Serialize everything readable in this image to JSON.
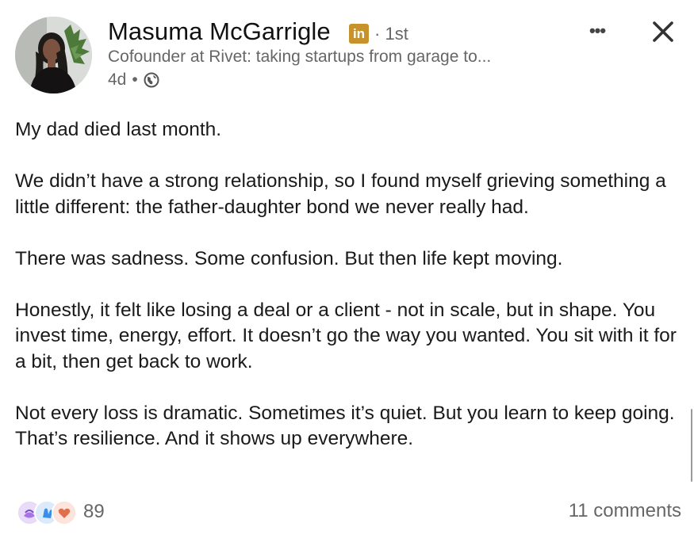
{
  "author": {
    "name": "Masuma McGarrigle",
    "badge": "in",
    "degree": "1st",
    "headline": "Cofounder at Rivet: taking startups from garage to...",
    "time": "4d",
    "visibility_icon": "globe-icon"
  },
  "actions": {
    "more_label": "•••",
    "more_icon": "ellipsis-icon",
    "close_icon": "close-icon"
  },
  "post": {
    "paragraphs": [
      "My dad died last month.",
      "We didn’t have a strong relationship, so I found myself grieving something a little different: the father-daughter bond we never really had.",
      "There was sadness. Some confusion. But then life kept moving.",
      "Honestly, it felt like losing a deal or a client - not in scale, but in shape. You invest time, energy, effort. It doesn’t go the way you wanted. You sit with it for a bit, then get back to work.",
      "Not every loss is dramatic. Sometimes it’s quiet. But you learn to keep going. That’s resilience. And it shows up everywhere."
    ]
  },
  "social": {
    "reaction_count": "89",
    "reaction_icons": [
      "support-icon",
      "celebrate-icon",
      "love-icon"
    ],
    "comments": "11 comments"
  },
  "colors": {
    "badge": "#c7922b",
    "muted_text": "#666666",
    "love": "#df704d",
    "celebrate": "#378fe9",
    "support": "#a872e8"
  }
}
